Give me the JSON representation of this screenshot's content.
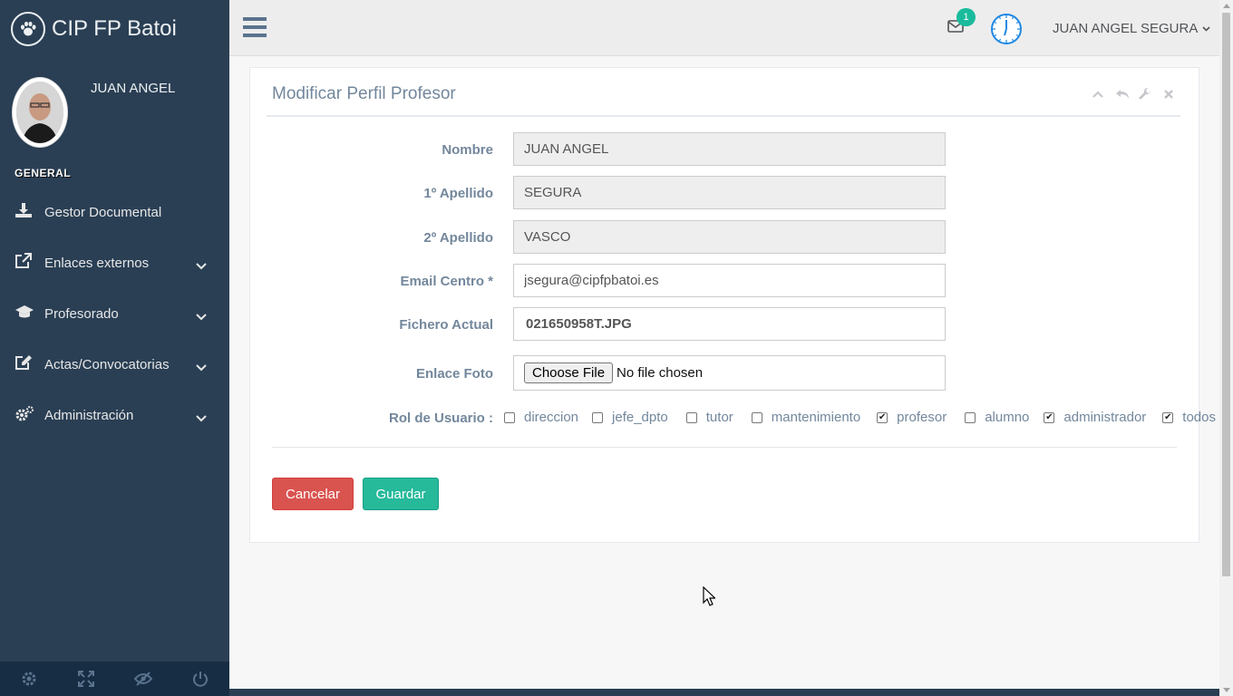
{
  "brand": {
    "title": "CIP FP Batoi",
    "icon": "paw-icon"
  },
  "profile": {
    "name": "JUAN ANGEL"
  },
  "sidebar": {
    "section_title": "GENERAL",
    "items": [
      {
        "label": "Gestor Documental",
        "icon": "download-icon",
        "has_submenu": false
      },
      {
        "label": "Enlaces externos",
        "icon": "external-link-icon",
        "has_submenu": true
      },
      {
        "label": "Profesorado",
        "icon": "graduation-cap-icon",
        "has_submenu": true
      },
      {
        "label": "Actas/Convocatorias",
        "icon": "edit-icon",
        "has_submenu": true
      },
      {
        "label": "Administración",
        "icon": "gears-icon",
        "has_submenu": true
      }
    ],
    "footer_icons": [
      "settings-icon",
      "fullscreen-icon",
      "eye-slash-icon",
      "power-icon"
    ]
  },
  "topnav": {
    "mail_badge": "1",
    "user_name": "JUAN ANGEL SEGURA"
  },
  "panel": {
    "title": "Modificar Perfil Profesor",
    "tools": [
      "chevron-up-icon",
      "reply-icon",
      "wrench-icon",
      "close-icon"
    ]
  },
  "form": {
    "nombre": {
      "label": "Nombre",
      "value": "JUAN ANGEL"
    },
    "apellido1": {
      "label": "1º Apellido",
      "value": "SEGURA"
    },
    "apellido2": {
      "label": "2º Apellido",
      "value": "VASCO"
    },
    "email": {
      "label": "Email Centro *",
      "value": "jsegura@cipfpbatoi.es"
    },
    "fichero": {
      "label": "Fichero Actual",
      "value": "021650958T.JPG"
    },
    "foto": {
      "label": "Enlace Foto",
      "button": "Choose File",
      "status": "No file chosen"
    },
    "roles_label": "Rol de Usuario :",
    "roles": [
      {
        "label": "direccion",
        "checked": false
      },
      {
        "label": "jefe_dpto",
        "checked": false
      },
      {
        "label": "tutor",
        "checked": false
      },
      {
        "label": "mantenimiento",
        "checked": false
      },
      {
        "label": "profesor",
        "checked": true
      },
      {
        "label": "alumno",
        "checked": false
      },
      {
        "label": "administrador",
        "checked": true
      },
      {
        "label": "todos",
        "checked": true
      }
    ],
    "cancel_label": "Cancelar",
    "save_label": "Guardar"
  },
  "colors": {
    "sidebar": "#2A3F54",
    "cancel": "#D9534F",
    "save": "#26B99A",
    "badge": "#1ABB9C",
    "clock": "#1E88E5"
  }
}
